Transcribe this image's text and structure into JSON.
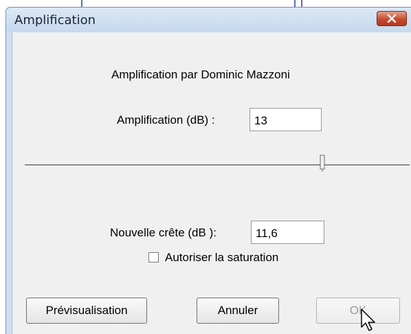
{
  "window": {
    "title": "Amplification",
    "close_icon": "close-x-icon"
  },
  "dialog": {
    "heading": "Amplification par Dominic Mazzoni",
    "amplification_label": "Amplification (dB) :",
    "amplification_value": "13",
    "slider_level_percent": 78,
    "peak_label": "Nouvelle crête (dB ):",
    "peak_value": "11,6",
    "clipping_label": "Autoriser la saturation",
    "clipping_checked": false
  },
  "buttons": {
    "preview": "Prévisualisation",
    "cancel": "Annuler",
    "ok": "OK"
  },
  "colors": {
    "titlebar": "#c6d9ef",
    "close_button": "#c64b2f",
    "dialog_background": "#f0f0f0"
  }
}
